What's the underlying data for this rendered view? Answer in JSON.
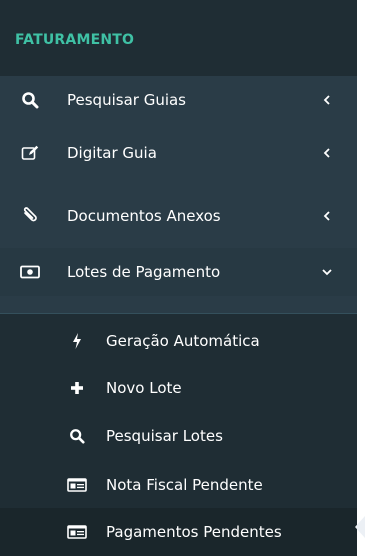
{
  "colors": {
    "sidebar_bg": "#2a3c47",
    "header_bg": "#1f2d34",
    "submenu_bg": "#1f2d34",
    "header_text": "#3fc1a5",
    "text": "#ffffff",
    "active_notch": "#ecf0f5"
  },
  "header": {
    "label": "FATURAMENTO"
  },
  "menu": [
    {
      "label": "Pesquisar Guias",
      "icon": "search-icon",
      "expanded": false
    },
    {
      "label": "Digitar Guia",
      "icon": "edit-icon",
      "expanded": false
    },
    {
      "label": "Documentos Anexos",
      "icon": "paperclip-icon",
      "expanded": false
    },
    {
      "label": "Lotes de Pagamento",
      "icon": "money-icon",
      "expanded": true
    }
  ],
  "submenu": [
    {
      "label": "Geração Automática",
      "icon": "bolt-icon",
      "active": false
    },
    {
      "label": "Novo Lote",
      "icon": "plus-icon",
      "active": false
    },
    {
      "label": "Pesquisar Lotes",
      "icon": "search-icon",
      "active": false
    },
    {
      "label": "Nota Fiscal Pendente",
      "icon": "id-card-icon",
      "active": false
    },
    {
      "label": "Pagamentos Pendentes",
      "icon": "id-card-icon",
      "active": true
    }
  ]
}
